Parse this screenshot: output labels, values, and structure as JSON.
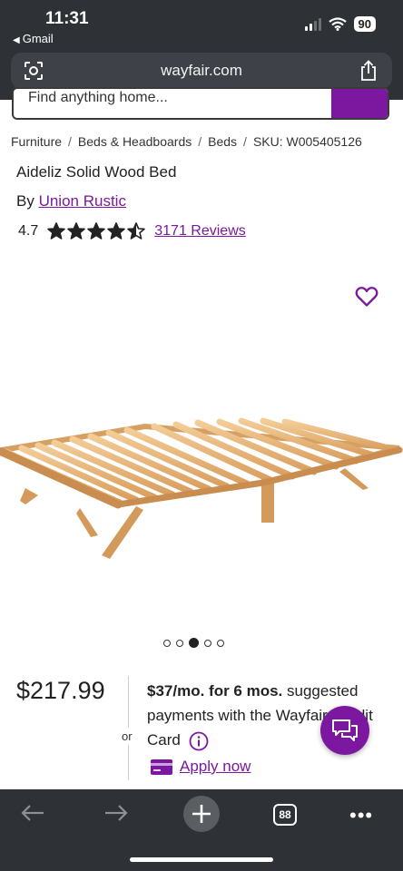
{
  "status": {
    "time": "11:31",
    "back_app": "Gmail",
    "battery": "90"
  },
  "browser": {
    "url": "wayfair.com",
    "tab_count": "88"
  },
  "search": {
    "placeholder": "Find anything home..."
  },
  "breadcrumb": [
    "Furniture",
    "Beds & Headboards",
    "Beds",
    "SKU: W005405126"
  ],
  "product": {
    "title": "Aideliz Solid Wood Bed",
    "by_label": "By",
    "brand": "Union Rustic",
    "rating": "4.7",
    "rating_value": 4.5,
    "reviews": "3171 Reviews",
    "image_count": 5,
    "active_image": 3
  },
  "pricing": {
    "price": "$217.99",
    "or": "or",
    "monthly": "$37/mo. for 6 mos.",
    "financing_text": " suggested payments with the Wayfair Credit Card",
    "apply": "Apply now"
  },
  "colors": {
    "brand_purple": "#7b189f",
    "chrome_dark": "#2e3136"
  },
  "icons": [
    "gmail-back-icon",
    "signal-icon",
    "wifi-icon",
    "battery-icon",
    "lens-icon",
    "share-icon",
    "search-icon",
    "heart-icon",
    "star-icon",
    "info-icon",
    "credit-card-icon",
    "chat-icon",
    "back-arrow-icon",
    "forward-arrow-icon",
    "new-tab-icon",
    "tabs-icon",
    "more-icon"
  ]
}
